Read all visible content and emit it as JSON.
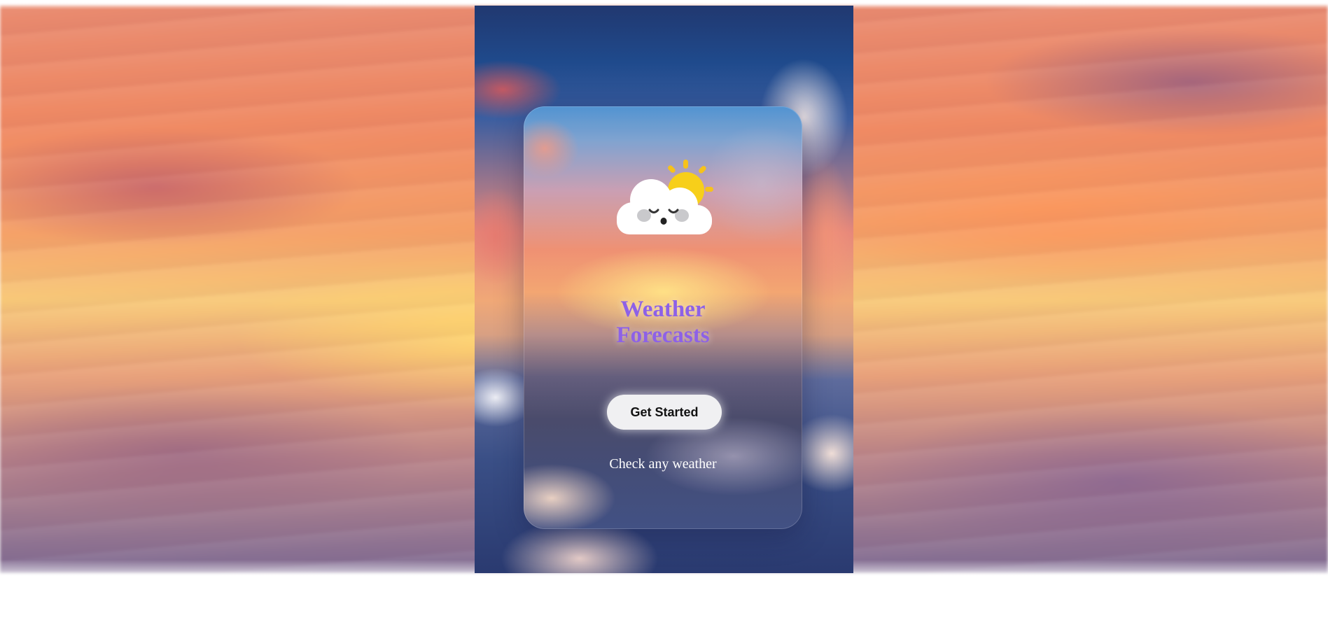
{
  "app": {
    "title": "Weather Forecasts",
    "title_line1": "Weather",
    "title_line2": "Forecasts"
  },
  "hero": {
    "logo_icon": "cloud-sun-icon",
    "cta_label": "Get Started",
    "tagline": "Check any weather"
  },
  "colors": {
    "title": "#8d61e7",
    "button_bg": "#f0f0f2",
    "button_text": "#111111",
    "tagline": "#ffffff"
  }
}
